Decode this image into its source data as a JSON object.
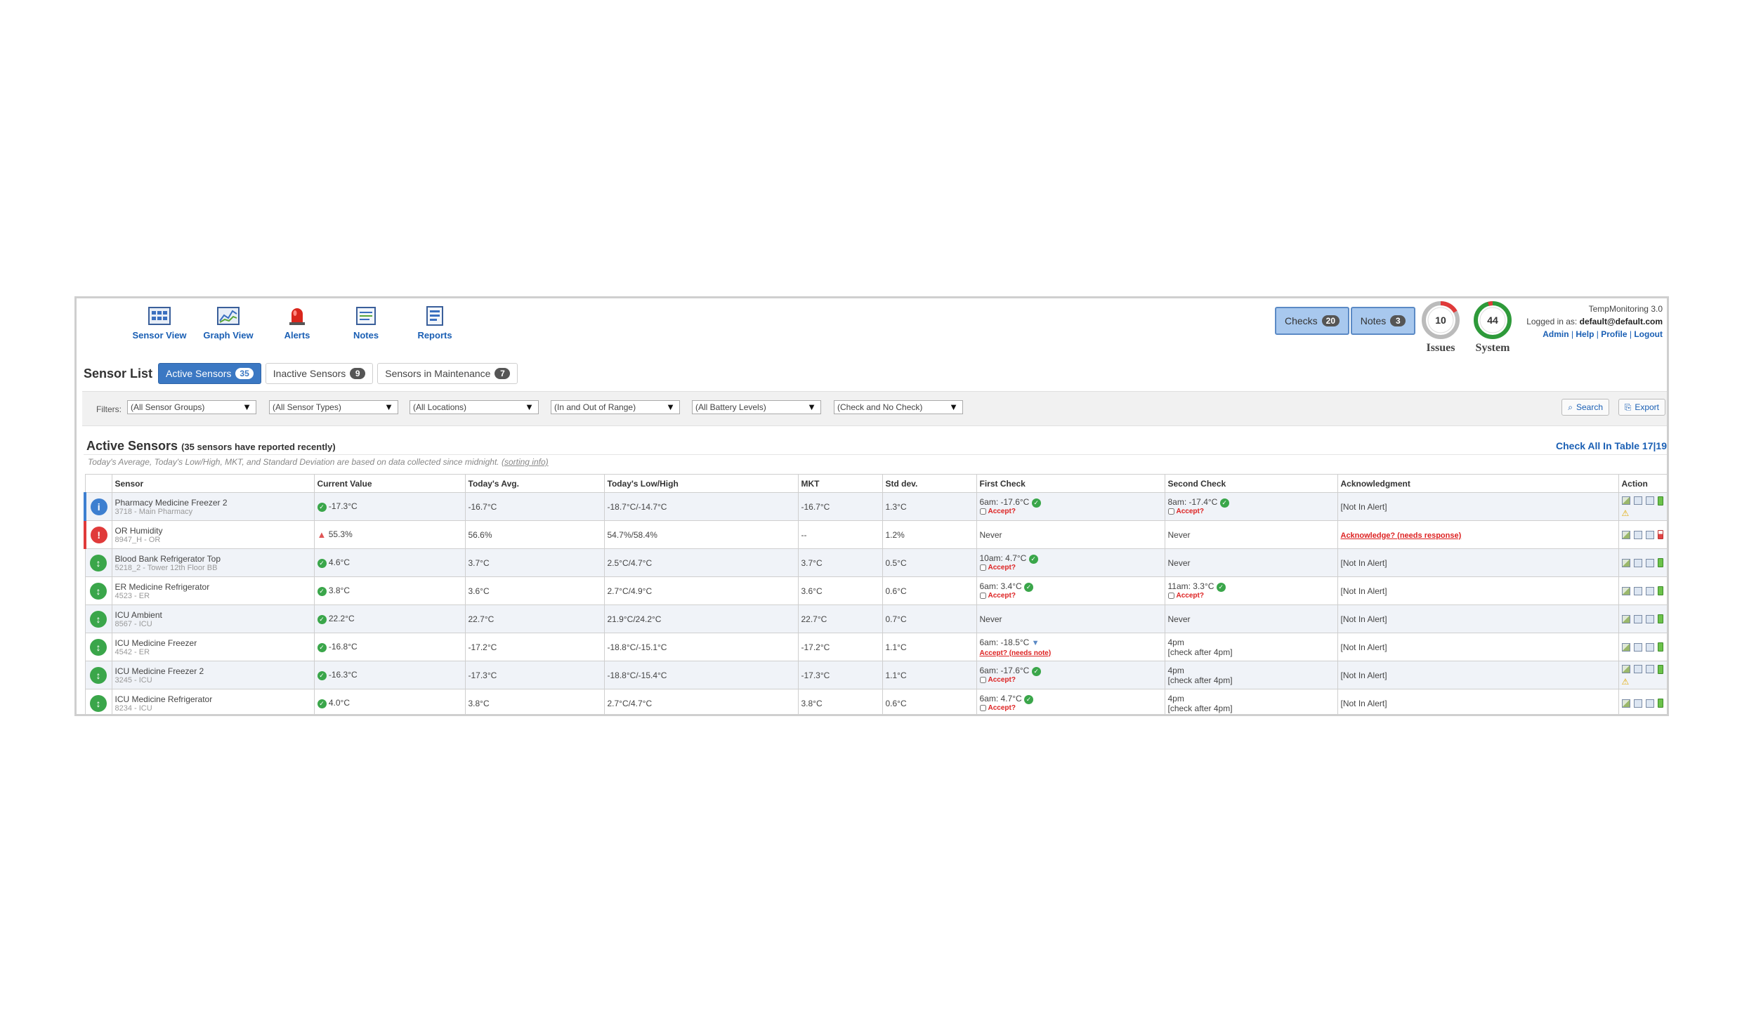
{
  "nav": [
    {
      "label": "Sensor View",
      "icon": "sensor-view-icon"
    },
    {
      "label": "Graph View",
      "icon": "graph-view-icon"
    },
    {
      "label": "Alerts",
      "icon": "alert-siren-icon"
    },
    {
      "label": "Notes",
      "icon": "notes-icon"
    },
    {
      "label": "Reports",
      "icon": "reports-icon"
    }
  ],
  "header": {
    "checks_label": "Checks",
    "checks_count": "20",
    "notes_label": "Notes",
    "notes_count": "3",
    "issues_value": "10",
    "issues_label": "Issues",
    "system_value": "44",
    "system_label": "System",
    "app_version": "TempMonitoring 3.0",
    "logged_in_prefix": "Logged in as:",
    "user": "default@default.com",
    "links": [
      "Admin",
      "Help",
      "Profile",
      "Logout"
    ]
  },
  "sensor_list": {
    "title": "Sensor List",
    "tabs": [
      {
        "label": "Active Sensors",
        "count": "35"
      },
      {
        "label": "Inactive Sensors",
        "count": "9"
      },
      {
        "label": "Sensors in Maintenance",
        "count": "7"
      }
    ]
  },
  "filters": {
    "label": "Filters:",
    "selects": [
      "(All Sensor Groups)",
      "(All Sensor Types)",
      "(All Locations)",
      "(In and Out of Range)",
      "(All Battery Levels)",
      "(Check and No Check)"
    ],
    "search_label": "Search",
    "export_label": "Export"
  },
  "section": {
    "title": "Active Sensors",
    "subtitle": "(35 sensors have reported recently)",
    "check_all": "Check All In Table 17|19",
    "note": "Today's Average, Today's Low/High, MKT, and Standard Deviation are based on data collected since midnight.",
    "sorting_link": "(sorting info)"
  },
  "table": {
    "headers": [
      "Sensor",
      "Current Value",
      "Today's Avg.",
      "Today's Low/High",
      "MKT",
      "Std dev.",
      "First Check",
      "Second Check",
      "Acknowledgment",
      "Action"
    ],
    "rows": [
      {
        "status": "info",
        "name": "Pharmacy Medicine Freezer 2",
        "sub": "3718 - Main Pharmacy",
        "value": "-17.3°C",
        "value_state": "ok",
        "avg": "-16.7°C",
        "lowhigh": "-18.7°C/-14.7°C",
        "mkt": "-16.7°C",
        "std": "1.3°C",
        "first": "6am: -17.6°C",
        "first_state": "ok",
        "first_action": "Accept?",
        "second": "8am: -17.4°C",
        "second_state": "ok",
        "second_action": "Accept?",
        "second_sub": "",
        "ack": "[Not In Alert]",
        "ack_alert": false,
        "battery": "good",
        "warn": true
      },
      {
        "status": "alert",
        "name": "OR Humidity",
        "sub": "8947_H - OR",
        "value": "55.3%",
        "value_state": "warn",
        "avg": "56.6%",
        "lowhigh": "54.7%/58.4%",
        "mkt": "--",
        "std": "1.2%",
        "first": "Never",
        "first_state": "",
        "first_action": "",
        "second": "Never",
        "second_state": "",
        "second_action": "",
        "second_sub": "",
        "ack": "Acknowledge? (needs response)",
        "ack_alert": true,
        "battery": "low",
        "warn": false
      },
      {
        "status": "ok",
        "name": "Blood Bank Refrigerator Top",
        "sub": "5218_2 - Tower 12th Floor BB",
        "value": "4.6°C",
        "value_state": "ok",
        "avg": "3.7°C",
        "lowhigh": "2.5°C/4.7°C",
        "mkt": "3.7°C",
        "std": "0.5°C",
        "first": "10am: 4.7°C",
        "first_state": "ok",
        "first_action": "Accept?",
        "second": "Never",
        "second_state": "",
        "second_action": "",
        "second_sub": "",
        "ack": "[Not In Alert]",
        "ack_alert": false,
        "battery": "good",
        "warn": false
      },
      {
        "status": "ok",
        "name": "ER Medicine Refrigerator",
        "sub": "4523 - ER",
        "value": "3.8°C",
        "value_state": "ok",
        "avg": "3.6°C",
        "lowhigh": "2.7°C/4.9°C",
        "mkt": "3.6°C",
        "std": "0.6°C",
        "first": "6am: 3.4°C",
        "first_state": "ok",
        "first_action": "Accept?",
        "second": "11am: 3.3°C",
        "second_state": "ok",
        "second_action": "Accept?",
        "second_sub": "",
        "ack": "[Not In Alert]",
        "ack_alert": false,
        "battery": "good",
        "warn": false
      },
      {
        "status": "ok",
        "name": "ICU Ambient",
        "sub": "8567 - ICU",
        "value": "22.2°C",
        "value_state": "ok",
        "avg": "22.7°C",
        "lowhigh": "21.9°C/24.2°C",
        "mkt": "22.7°C",
        "std": "0.7°C",
        "first": "Never",
        "first_state": "",
        "first_action": "",
        "second": "Never",
        "second_state": "",
        "second_action": "",
        "second_sub": "",
        "ack": "[Not In Alert]",
        "ack_alert": false,
        "battery": "good",
        "warn": false
      },
      {
        "status": "ok",
        "name": "ICU Medicine Freezer",
        "sub": "4542 - ER",
        "value": "-16.8°C",
        "value_state": "ok",
        "avg": "-17.2°C",
        "lowhigh": "-18.8°C/-15.1°C",
        "mkt": "-17.2°C",
        "std": "1.1°C",
        "first": "6am: -18.5°C",
        "first_state": "down",
        "first_action": "Accept? (needs note)",
        "second": "4pm",
        "second_state": "",
        "second_action": "",
        "second_sub": "[check after 4pm]",
        "ack": "[Not In Alert]",
        "ack_alert": false,
        "battery": "good",
        "warn": false
      },
      {
        "status": "ok",
        "name": "ICU Medicine Freezer 2",
        "sub": "3245 - ICU",
        "value": "-16.3°C",
        "value_state": "ok",
        "avg": "-17.3°C",
        "lowhigh": "-18.8°C/-15.4°C",
        "mkt": "-17.3°C",
        "std": "1.1°C",
        "first": "6am: -17.6°C",
        "first_state": "ok",
        "first_action": "Accept?",
        "second": "4pm",
        "second_state": "",
        "second_action": "",
        "second_sub": "[check after 4pm]",
        "ack": "[Not In Alert]",
        "ack_alert": false,
        "battery": "good",
        "warn": true
      },
      {
        "status": "ok",
        "name": "ICU Medicine Refrigerator",
        "sub": "8234 - ICU",
        "value": "4.0°C",
        "value_state": "ok",
        "avg": "3.8°C",
        "lowhigh": "2.7°C/4.7°C",
        "mkt": "3.8°C",
        "std": "0.6°C",
        "first": "6am: 4.7°C",
        "first_state": "ok",
        "first_action": "Accept?",
        "second": "4pm",
        "second_state": "",
        "second_action": "",
        "second_sub": "[check after 4pm]",
        "ack": "[Not In Alert]",
        "ack_alert": false,
        "battery": "good",
        "warn": false
      }
    ]
  },
  "colors": {
    "accent": "#3b78c3",
    "link": "#1a5fb4",
    "ok": "#3aa64a",
    "alert": "#e03a3a",
    "info": "#3d7fd0"
  }
}
